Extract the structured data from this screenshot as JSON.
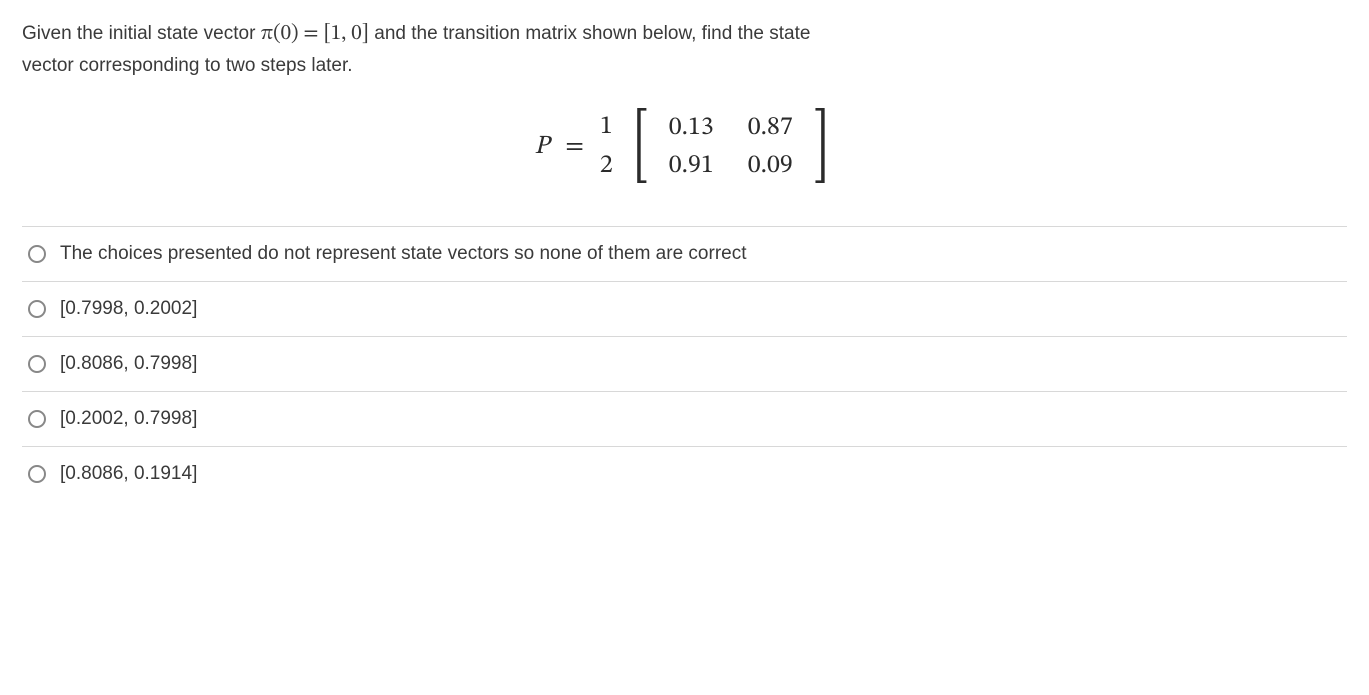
{
  "question": {
    "line1_prefix": "Given the initial state vector ",
    "pi_expr": "π(0) = [1, 0]",
    "line1_suffix": " and the transition matrix shown below, find the state",
    "line2": "vector corresponding to two steps later."
  },
  "matrix": {
    "lhs": "P",
    "eq": "=",
    "row_labels": [
      "1",
      "2"
    ],
    "cells": [
      "0.13",
      "0.87",
      "0.91",
      "0.09"
    ]
  },
  "options": [
    {
      "label": "The choices presented do not represent state vectors so none of them are correct"
    },
    {
      "label": "[0.7998, 0.2002]"
    },
    {
      "label": "[0.8086, 0.7998]"
    },
    {
      "label": "[0.2002, 0.7998]"
    },
    {
      "label": "[0.8086, 0.1914]"
    }
  ]
}
